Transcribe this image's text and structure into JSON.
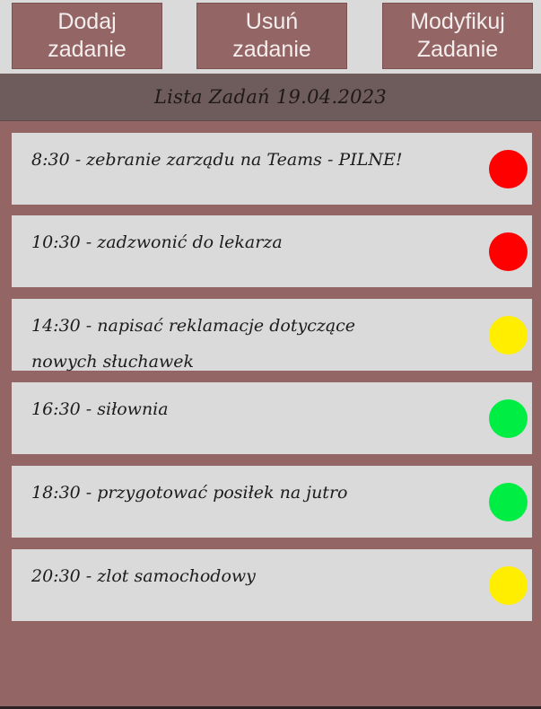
{
  "toolbar": {
    "add_label": "Dodaj\nzadanie",
    "delete_label": "Usuń\nzadanie",
    "modify_label": "Modyfikuj\nZadanie"
  },
  "header": {
    "title": "Lista Zadań 19.04.2023"
  },
  "colors": {
    "button_bg": "#946565",
    "header_bg": "#6e5c5c",
    "panel_bg": "#946565",
    "card_bg": "#dadada",
    "priority_high": "#ff0000",
    "priority_medium": "#ffee00",
    "priority_low": "#00ee44"
  },
  "tasks": [
    {
      "text": "8:30 - zebranie zarządu na Teams - PILNE!",
      "priority": "high"
    },
    {
      "text": "10:30 - zadzwonić do lekarza",
      "priority": "high"
    },
    {
      "text": "14:30 - napisać reklamacje dotyczące nowych słuchawek",
      "priority": "medium"
    },
    {
      "text": "16:30 - siłownia",
      "priority": "low"
    },
    {
      "text": " 18:30 - przygotować posiłek na jutro",
      "priority": "low"
    },
    {
      "text": "20:30 - zlot samochodowy",
      "priority": "medium"
    }
  ]
}
